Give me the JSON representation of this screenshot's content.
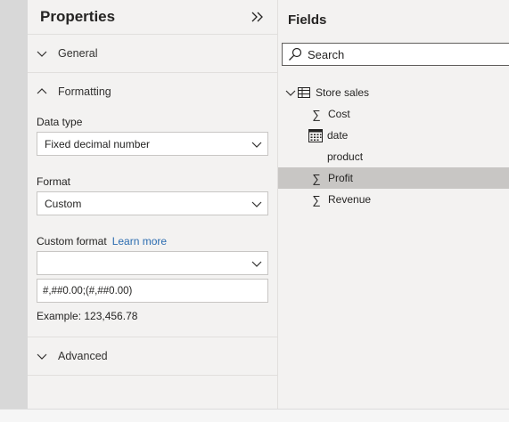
{
  "properties": {
    "title": "Properties",
    "sections": {
      "general": "General",
      "formatting": "Formatting",
      "advanced": "Advanced"
    },
    "data_type": {
      "label": "Data type",
      "value": "Fixed decimal number"
    },
    "format": {
      "label": "Format",
      "value": "Custom"
    },
    "custom_format": {
      "label": "Custom format",
      "link": "Learn more",
      "dropdown_value": "",
      "input_value": "#,##0.00;(#,##0.00)",
      "example": "Example: 123,456.78"
    }
  },
  "fields": {
    "title": "Fields",
    "search_placeholder": "Search",
    "table": {
      "name": "Store sales",
      "items": [
        {
          "label": "Cost",
          "icon": "sigma-icon"
        },
        {
          "label": "date",
          "icon": "calendar-icon"
        },
        {
          "label": "product",
          "icon": "none"
        },
        {
          "label": "Profit",
          "icon": "sigma-icon",
          "selected": true
        },
        {
          "label": "Revenue",
          "icon": "sigma-icon"
        }
      ]
    }
  },
  "colors": {
    "panel_bg": "#f3f2f1",
    "selected_row": "#c8c6c4",
    "link": "#2b6cb0"
  }
}
